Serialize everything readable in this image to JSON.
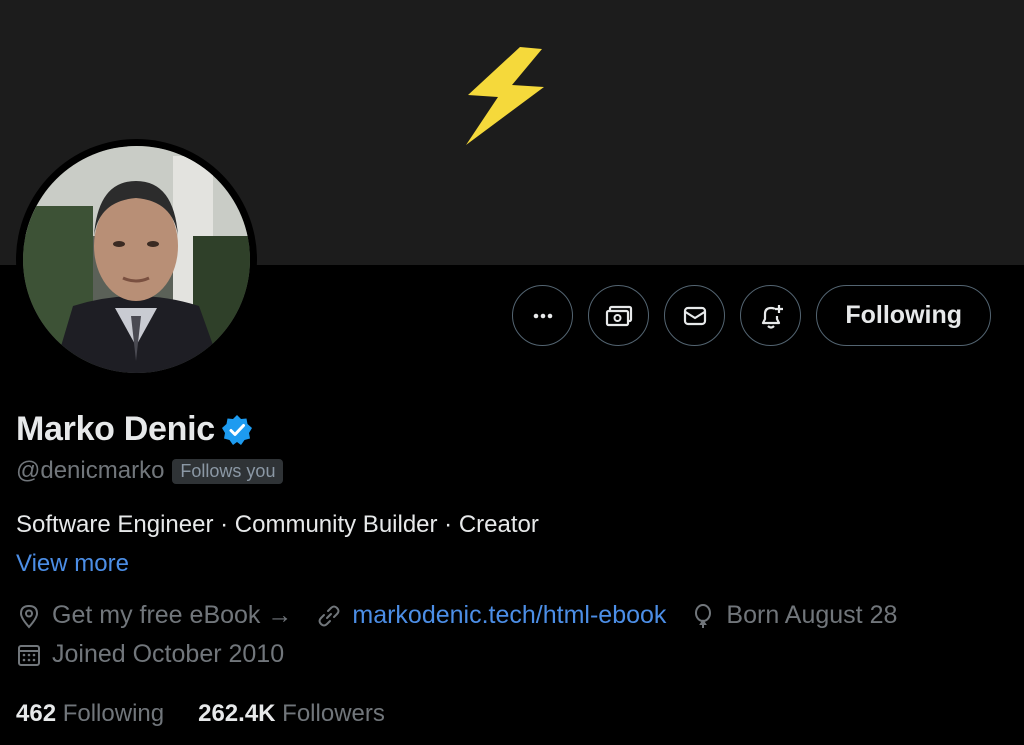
{
  "header": {
    "banner_icon": "lightning-bolt-icon"
  },
  "actions": {
    "more_icon": "more-dots-icon",
    "tip_icon": "money-icon",
    "message_icon": "envelope-icon",
    "notify_icon": "bell-plus-icon",
    "following_label": "Following"
  },
  "profile": {
    "name": "Marko Denic",
    "verified_icon": "verified-badge-icon",
    "handle": "@denicmarko",
    "follows_you": "Follows you",
    "bio": "Software Engineer · Community Builder · Creator",
    "view_more": "View more"
  },
  "meta": {
    "location": "Get my free eBook →",
    "website": "markodenic.tech/html-ebook",
    "birthday": "Born August 28",
    "joined": "Joined October 2010"
  },
  "stats": {
    "following_count": "462",
    "following_label": "Following",
    "followers_count": "262.4K",
    "followers_label": "Followers"
  },
  "colors": {
    "accent": "#4c8ee6",
    "verified": "#1d9bf0",
    "bolt": "#f5d93b",
    "banner": "#1c1c1c"
  }
}
